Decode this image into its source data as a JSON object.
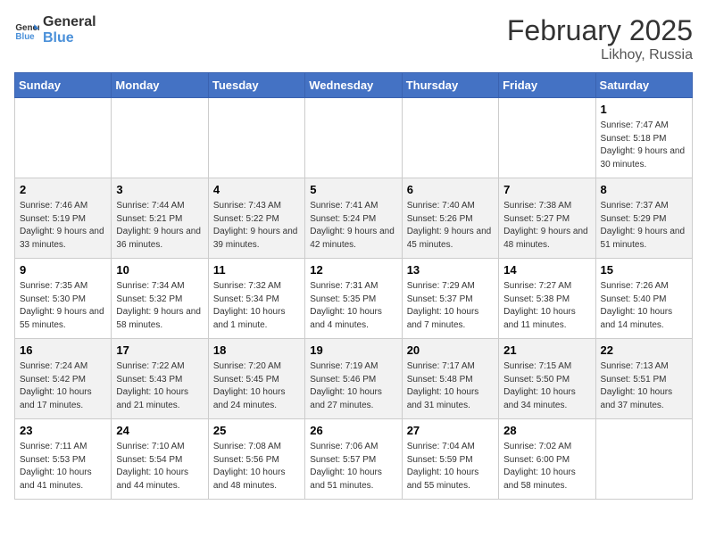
{
  "header": {
    "logo_general": "General",
    "logo_blue": "Blue",
    "month_year": "February 2025",
    "location": "Likhoy, Russia"
  },
  "weekdays": [
    "Sunday",
    "Monday",
    "Tuesday",
    "Wednesday",
    "Thursday",
    "Friday",
    "Saturday"
  ],
  "weeks": [
    [
      {
        "day": "",
        "info": ""
      },
      {
        "day": "",
        "info": ""
      },
      {
        "day": "",
        "info": ""
      },
      {
        "day": "",
        "info": ""
      },
      {
        "day": "",
        "info": ""
      },
      {
        "day": "",
        "info": ""
      },
      {
        "day": "1",
        "info": "Sunrise: 7:47 AM\nSunset: 5:18 PM\nDaylight: 9 hours and 30 minutes."
      }
    ],
    [
      {
        "day": "2",
        "info": "Sunrise: 7:46 AM\nSunset: 5:19 PM\nDaylight: 9 hours and 33 minutes."
      },
      {
        "day": "3",
        "info": "Sunrise: 7:44 AM\nSunset: 5:21 PM\nDaylight: 9 hours and 36 minutes."
      },
      {
        "day": "4",
        "info": "Sunrise: 7:43 AM\nSunset: 5:22 PM\nDaylight: 9 hours and 39 minutes."
      },
      {
        "day": "5",
        "info": "Sunrise: 7:41 AM\nSunset: 5:24 PM\nDaylight: 9 hours and 42 minutes."
      },
      {
        "day": "6",
        "info": "Sunrise: 7:40 AM\nSunset: 5:26 PM\nDaylight: 9 hours and 45 minutes."
      },
      {
        "day": "7",
        "info": "Sunrise: 7:38 AM\nSunset: 5:27 PM\nDaylight: 9 hours and 48 minutes."
      },
      {
        "day": "8",
        "info": "Sunrise: 7:37 AM\nSunset: 5:29 PM\nDaylight: 9 hours and 51 minutes."
      }
    ],
    [
      {
        "day": "9",
        "info": "Sunrise: 7:35 AM\nSunset: 5:30 PM\nDaylight: 9 hours and 55 minutes."
      },
      {
        "day": "10",
        "info": "Sunrise: 7:34 AM\nSunset: 5:32 PM\nDaylight: 9 hours and 58 minutes."
      },
      {
        "day": "11",
        "info": "Sunrise: 7:32 AM\nSunset: 5:34 PM\nDaylight: 10 hours and 1 minute."
      },
      {
        "day": "12",
        "info": "Sunrise: 7:31 AM\nSunset: 5:35 PM\nDaylight: 10 hours and 4 minutes."
      },
      {
        "day": "13",
        "info": "Sunrise: 7:29 AM\nSunset: 5:37 PM\nDaylight: 10 hours and 7 minutes."
      },
      {
        "day": "14",
        "info": "Sunrise: 7:27 AM\nSunset: 5:38 PM\nDaylight: 10 hours and 11 minutes."
      },
      {
        "day": "15",
        "info": "Sunrise: 7:26 AM\nSunset: 5:40 PM\nDaylight: 10 hours and 14 minutes."
      }
    ],
    [
      {
        "day": "16",
        "info": "Sunrise: 7:24 AM\nSunset: 5:42 PM\nDaylight: 10 hours and 17 minutes."
      },
      {
        "day": "17",
        "info": "Sunrise: 7:22 AM\nSunset: 5:43 PM\nDaylight: 10 hours and 21 minutes."
      },
      {
        "day": "18",
        "info": "Sunrise: 7:20 AM\nSunset: 5:45 PM\nDaylight: 10 hours and 24 minutes."
      },
      {
        "day": "19",
        "info": "Sunrise: 7:19 AM\nSunset: 5:46 PM\nDaylight: 10 hours and 27 minutes."
      },
      {
        "day": "20",
        "info": "Sunrise: 7:17 AM\nSunset: 5:48 PM\nDaylight: 10 hours and 31 minutes."
      },
      {
        "day": "21",
        "info": "Sunrise: 7:15 AM\nSunset: 5:50 PM\nDaylight: 10 hours and 34 minutes."
      },
      {
        "day": "22",
        "info": "Sunrise: 7:13 AM\nSunset: 5:51 PM\nDaylight: 10 hours and 37 minutes."
      }
    ],
    [
      {
        "day": "23",
        "info": "Sunrise: 7:11 AM\nSunset: 5:53 PM\nDaylight: 10 hours and 41 minutes."
      },
      {
        "day": "24",
        "info": "Sunrise: 7:10 AM\nSunset: 5:54 PM\nDaylight: 10 hours and 44 minutes."
      },
      {
        "day": "25",
        "info": "Sunrise: 7:08 AM\nSunset: 5:56 PM\nDaylight: 10 hours and 48 minutes."
      },
      {
        "day": "26",
        "info": "Sunrise: 7:06 AM\nSunset: 5:57 PM\nDaylight: 10 hours and 51 minutes."
      },
      {
        "day": "27",
        "info": "Sunrise: 7:04 AM\nSunset: 5:59 PM\nDaylight: 10 hours and 55 minutes."
      },
      {
        "day": "28",
        "info": "Sunrise: 7:02 AM\nSunset: 6:00 PM\nDaylight: 10 hours and 58 minutes."
      },
      {
        "day": "",
        "info": ""
      }
    ]
  ]
}
